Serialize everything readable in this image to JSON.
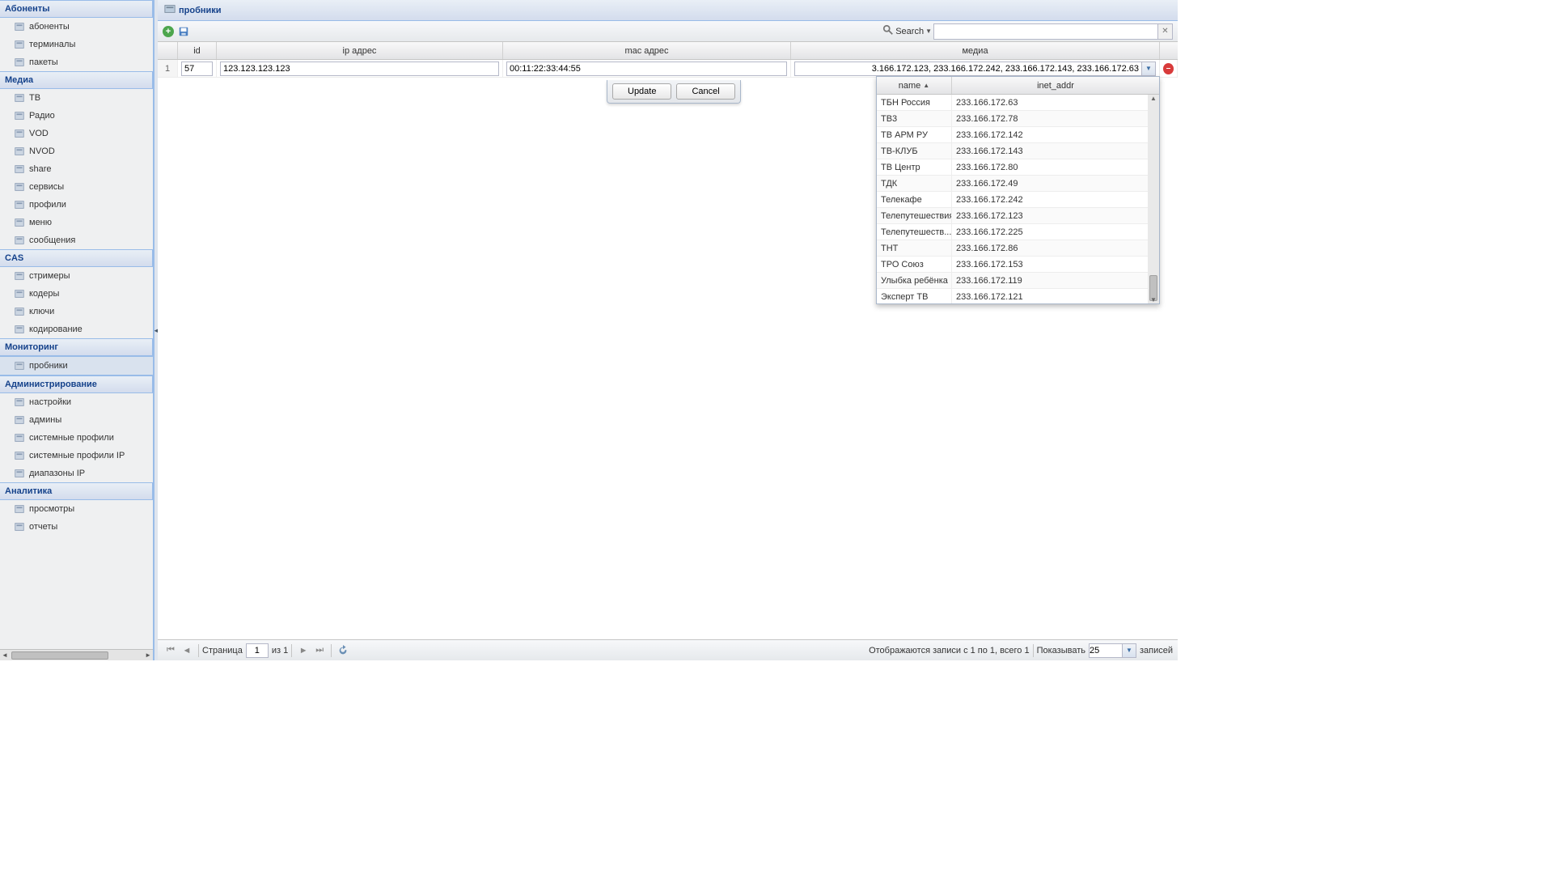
{
  "sidebar": {
    "sections": [
      {
        "title": "Абоненты",
        "items": [
          {
            "label": "абоненты",
            "icon": "people-icon"
          },
          {
            "label": "терминалы",
            "icon": "terminal-icon"
          },
          {
            "label": "пакеты",
            "icon": "package-icon"
          }
        ]
      },
      {
        "title": "Медиа",
        "items": [
          {
            "label": "ТВ",
            "icon": "tv-icon"
          },
          {
            "label": "Радио",
            "icon": "radio-icon"
          },
          {
            "label": "VOD",
            "icon": "vod-icon"
          },
          {
            "label": "NVOD",
            "icon": "nvod-icon"
          },
          {
            "label": "share",
            "icon": "share-icon"
          },
          {
            "label": "сервисы",
            "icon": "star-icon"
          },
          {
            "label": "профили",
            "icon": "lock-icon"
          },
          {
            "label": "меню",
            "icon": "menu-icon"
          },
          {
            "label": "сообщения",
            "icon": "message-icon"
          }
        ]
      },
      {
        "title": "CAS",
        "items": [
          {
            "label": "стримеры",
            "icon": "server-icon"
          },
          {
            "label": "кодеры",
            "icon": "encoder-icon"
          },
          {
            "label": "ключи",
            "icon": "key-icon"
          },
          {
            "label": "кодирование",
            "icon": "encoding-icon"
          }
        ]
      },
      {
        "title": "Мониторинг",
        "items": [
          {
            "label": "пробники",
            "icon": "probe-icon",
            "active": true
          }
        ]
      },
      {
        "title": "Администрирование",
        "items": [
          {
            "label": "настройки",
            "icon": "wrench-icon"
          },
          {
            "label": "админы",
            "icon": "admin-icon"
          },
          {
            "label": "системные профили",
            "icon": "sysprofile-icon"
          },
          {
            "label": "системные профили IP",
            "icon": "sysprofile-ip-icon"
          },
          {
            "label": "диапазоны IP",
            "icon": "iprange-icon"
          }
        ]
      },
      {
        "title": "Аналитика",
        "items": [
          {
            "label": "просмотры",
            "icon": "views-icon"
          },
          {
            "label": "отчеты",
            "icon": "reports-icon"
          }
        ]
      }
    ]
  },
  "panel": {
    "title": "пробники"
  },
  "toolbar": {
    "search_label": "Search"
  },
  "grid": {
    "headers": {
      "id": "id",
      "ip": "ip адрес",
      "mac": "mac адрес",
      "media": "медиа"
    },
    "row": {
      "num": "1",
      "id": "57",
      "ip": "123.123.123.123",
      "mac": "00:11:22:33:44:55",
      "media": "3.166.172.123, 233.166.172.242, 233.166.172.143, 233.166.172.63"
    }
  },
  "editor": {
    "update": "Update",
    "cancel": "Cancel"
  },
  "dropdown": {
    "headers": {
      "name": "name",
      "addr": "inet_addr"
    },
    "rows": [
      {
        "name": "ТБН Россия",
        "addr": "233.166.172.63"
      },
      {
        "name": "ТВ3",
        "addr": "233.166.172.78"
      },
      {
        "name": "ТВ АРМ РУ",
        "addr": "233.166.172.142"
      },
      {
        "name": "ТВ-КЛУБ",
        "addr": "233.166.172.143"
      },
      {
        "name": "ТВ Центр",
        "addr": "233.166.172.80"
      },
      {
        "name": "ТДК",
        "addr": "233.166.172.49"
      },
      {
        "name": "Телекафе",
        "addr": "233.166.172.242"
      },
      {
        "name": "Телепутешествия",
        "addr": "233.166.172.123"
      },
      {
        "name": "Телепутешеств...",
        "addr": "233.166.172.225"
      },
      {
        "name": "ТНТ",
        "addr": "233.166.172.86"
      },
      {
        "name": "ТРО Союз",
        "addr": "233.166.172.153"
      },
      {
        "name": "Улыбка ребёнка",
        "addr": "233.166.172.119"
      },
      {
        "name": "Эксперт ТВ",
        "addr": "233.166.172.121"
      }
    ]
  },
  "footer": {
    "page_label": "Страница",
    "page_value": "1",
    "of_label": "из 1",
    "display_msg": "Отображаются записи с 1 по 1, всего 1",
    "show_label": "Показывать",
    "page_size": "25",
    "records_label": "записей"
  }
}
